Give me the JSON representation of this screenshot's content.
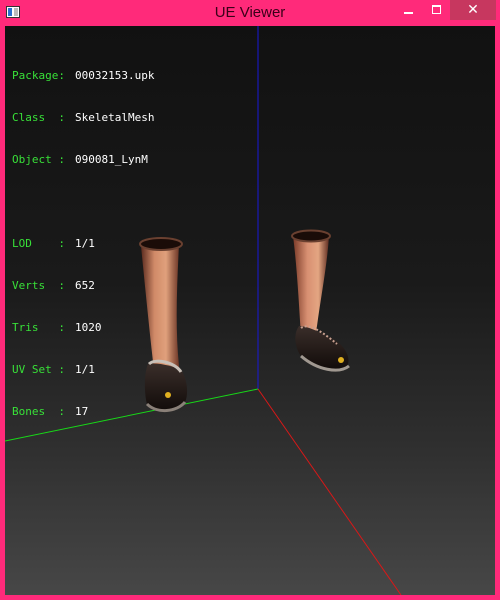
{
  "window": {
    "title": "UE Viewer",
    "close_label": "✕"
  },
  "info": {
    "package": {
      "label": "Package:",
      "value": "00032153.upk"
    },
    "class": {
      "label": "Class  :",
      "value": "SkeletalMesh"
    },
    "object": {
      "label": "Object :",
      "value": "090081_LynM"
    },
    "lod": {
      "label": "LOD    :",
      "value": "1/1"
    },
    "verts": {
      "label": "Verts  :",
      "value": "652"
    },
    "tris": {
      "label": "Tris   :",
      "value": "1020"
    },
    "uvset": {
      "label": "UV Set :",
      "value": "1/1"
    },
    "bones": {
      "label": "Bones  :",
      "value": "17"
    }
  },
  "colors": {
    "titlebar": "#ff2a7a",
    "label_green": "#38e038",
    "axis_x": "#d01010",
    "axis_y": "#10d010",
    "axis_z": "#1010d0"
  },
  "icons": {
    "app": "ue-viewer-app-icon",
    "minimize": "minimize-icon",
    "maximize": "maximize-icon",
    "close": "close-icon"
  }
}
